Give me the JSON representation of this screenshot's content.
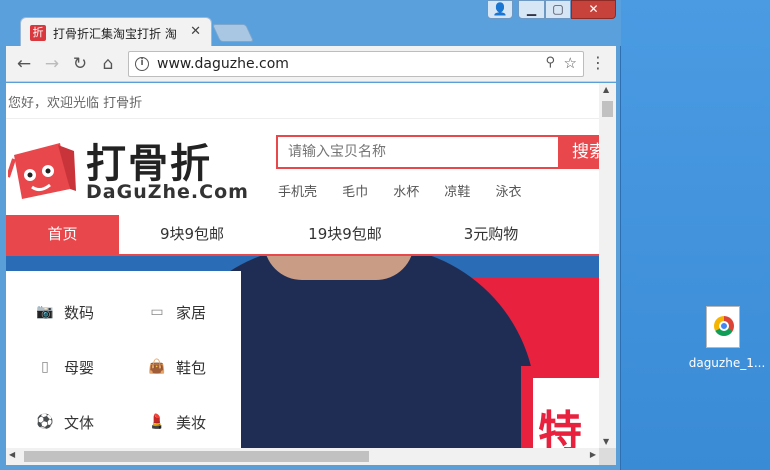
{
  "browser": {
    "tab_title": "打骨折汇集淘宝打折 淘",
    "tab_favicon": "折",
    "url": "www.daguzhe.com"
  },
  "page": {
    "greeting": "您好，欢迎光临 打骨折",
    "logo_cn": "打骨折",
    "logo_en": "DaGuZhe.Com",
    "search_placeholder": "请输入宝贝名称",
    "search_button": "搜索",
    "hotwords": [
      "手机壳",
      "毛巾",
      "水杯",
      "凉鞋",
      "泳衣"
    ],
    "nav": [
      {
        "label": "首页",
        "active": true
      },
      {
        "label": "9块9包邮",
        "active": false
      },
      {
        "label": "19块9包邮",
        "active": false
      },
      {
        "label": "3元购物",
        "active": false
      }
    ],
    "categories": [
      {
        "label": "数码",
        "icon": "camera-icon"
      },
      {
        "label": "家居",
        "icon": "sofa-icon"
      },
      {
        "label": "母婴",
        "icon": "baby-bottle-icon"
      },
      {
        "label": "鞋包",
        "icon": "bag-icon"
      },
      {
        "label": "文体",
        "icon": "ball-icon"
      },
      {
        "label": "美妆",
        "icon": "lipstick-icon"
      }
    ],
    "banner_char": "特"
  },
  "desktop": {
    "file_label": "daguzhe_1..."
  },
  "colors": {
    "accent": "#e8474c",
    "titlebar": "#5aa0dc",
    "desktop": "#3c8fd9"
  }
}
